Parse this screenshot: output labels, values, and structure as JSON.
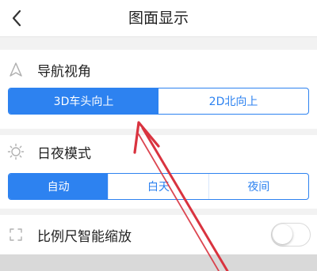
{
  "header": {
    "title": "图面显示",
    "back_icon": "chevron-left-icon"
  },
  "sections": {
    "navigation_view": {
      "label": "导航视角",
      "icon": "navigation-arrow-icon",
      "options": [
        "3D车头向上",
        "2D北向上"
      ],
      "selected": "3D车头向上"
    },
    "day_night_mode": {
      "label": "日夜模式",
      "icon": "sun-icon",
      "options": [
        "自动",
        "白天",
        "夜间"
      ],
      "selected": "自动"
    },
    "smart_scale": {
      "label": "比例尺智能缩放",
      "icon": "expand-corners-icon",
      "enabled": false
    }
  },
  "colors": {
    "accent": "#2d82f0",
    "annotation_arrow": "#d9333f",
    "background": "#f2f2f2"
  }
}
